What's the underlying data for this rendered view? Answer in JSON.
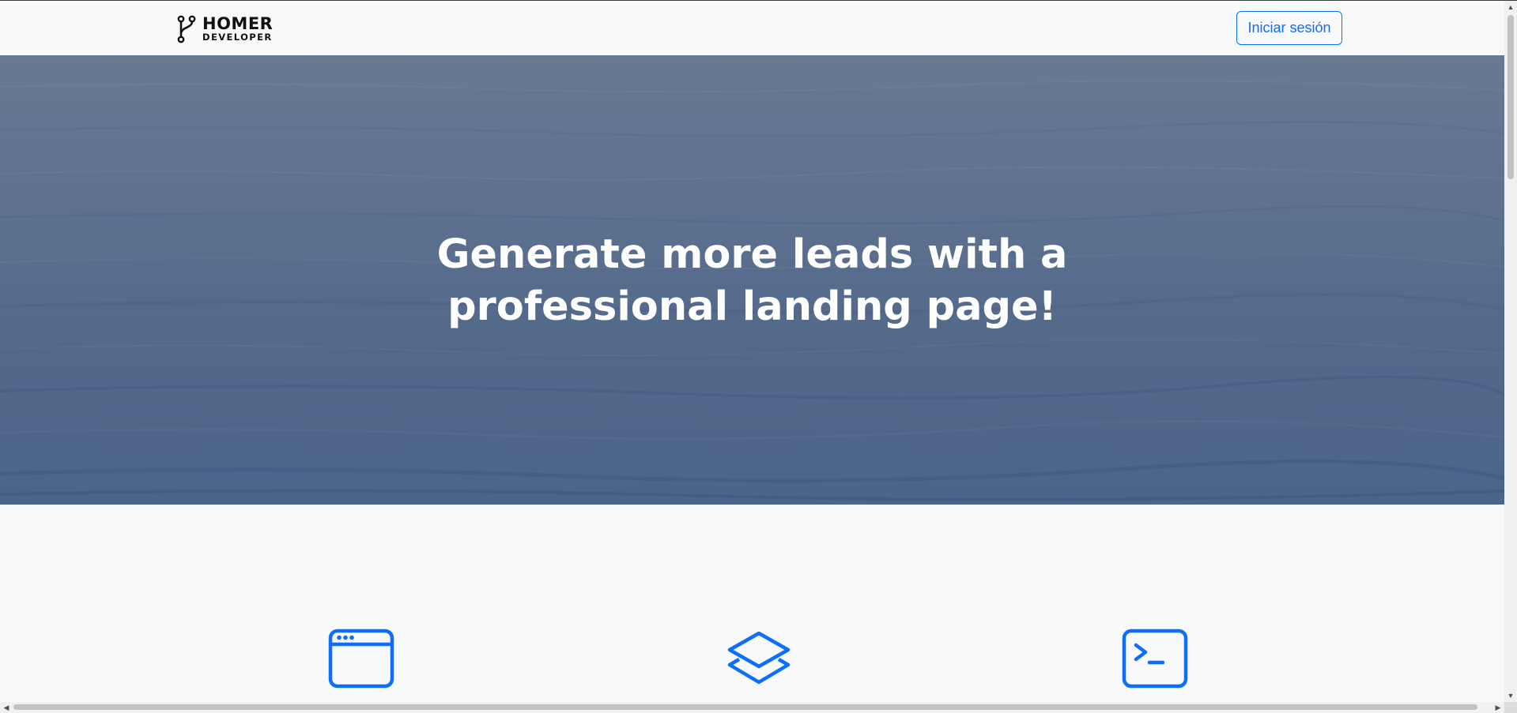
{
  "brand": {
    "line1": "HOMER",
    "line2": "DEVELOPER",
    "icon": "git-branch-icon"
  },
  "navbar": {
    "login_label": "Iniciar sesión"
  },
  "hero": {
    "title_line1": "Generate more leads with a",
    "title_line2": "professional landing page!"
  },
  "features": {
    "icons": [
      "window-icon",
      "layers-icon",
      "terminal-icon"
    ]
  },
  "colors": {
    "accent": "#0d6efd",
    "hero_text": "#ffffff",
    "background": "#f8f9fa"
  }
}
